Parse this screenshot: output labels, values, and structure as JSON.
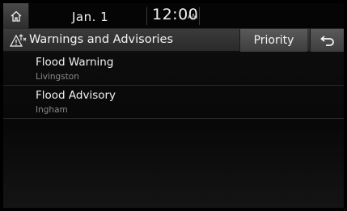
{
  "status_bar": {
    "date": "Jan.  1",
    "time": "12:00",
    "ampm": "AM",
    "home_icon": "home-icon"
  },
  "header": {
    "title": "Warnings and Advisories",
    "title_icon": "warning-advisory-icon",
    "priority_label": "Priority",
    "back_icon": "back-arrow-icon"
  },
  "alerts": [
    {
      "title": "Flood Warning",
      "location": "Livingston"
    },
    {
      "title": "Flood Advisory",
      "location": "Ingham"
    }
  ]
}
